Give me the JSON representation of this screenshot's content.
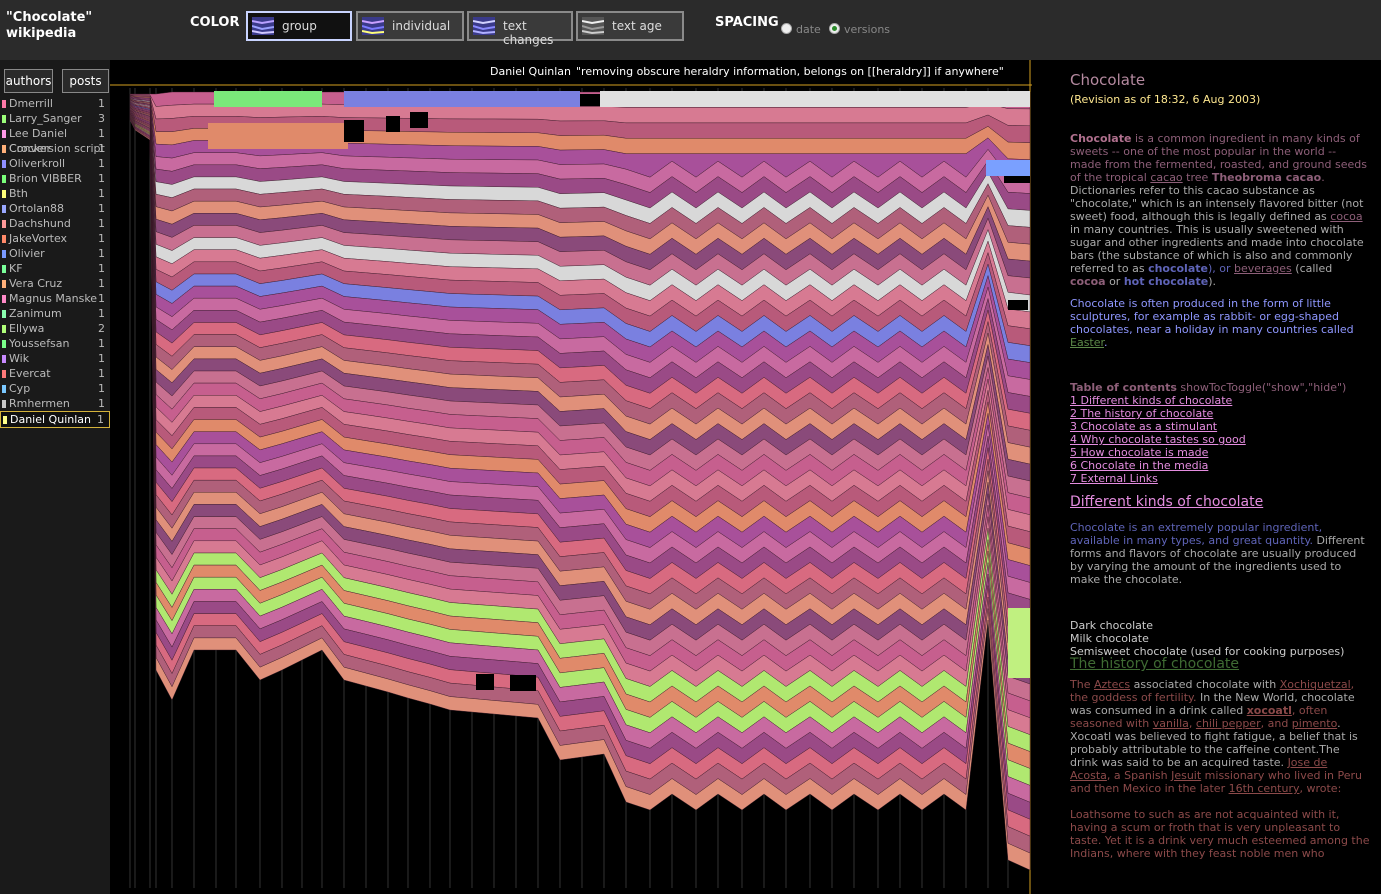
{
  "app": {
    "title_line1": "\"Chocolate\"",
    "title_line2": "wikipedia"
  },
  "color": {
    "label": "COLOR",
    "buttons": [
      {
        "label": "group",
        "active": true
      },
      {
        "label": "individual",
        "active": false
      },
      {
        "label": "text changes",
        "active": false
      },
      {
        "label": "text age",
        "active": false
      }
    ]
  },
  "spacing": {
    "label": "SPACING",
    "options": [
      {
        "label": "date",
        "selected": false
      },
      {
        "label": "versions",
        "selected": true
      }
    ]
  },
  "sidebar": {
    "tabs": [
      "authors",
      "posts"
    ],
    "authors": [
      {
        "name": "Dmerrill",
        "count": "1",
        "color": "#ff7aa8"
      },
      {
        "name": "Larry_Sanger",
        "count": "3",
        "color": "#9cff7a"
      },
      {
        "name": "Lee Daniel Crocker",
        "count": "1",
        "color": "#ff9ae6"
      },
      {
        "name": "Conversion script",
        "count": "1",
        "color": "#ffb07a"
      },
      {
        "name": "Oliverkroll",
        "count": "1",
        "color": "#8f8fff"
      },
      {
        "name": "Brion VIBBER",
        "count": "1",
        "color": "#7aff7a"
      },
      {
        "name": "Bth",
        "count": "1",
        "color": "#ffff7a"
      },
      {
        "name": "Ortolan88",
        "count": "1",
        "color": "#9aa8ff"
      },
      {
        "name": "Dachshund",
        "count": "1",
        "color": "#ff9a9a"
      },
      {
        "name": "JakeVortex",
        "count": "1",
        "color": "#ff8a6a"
      },
      {
        "name": "Olivier",
        "count": "1",
        "color": "#7a9aff"
      },
      {
        "name": "KF",
        "count": "1",
        "color": "#7aff9a"
      },
      {
        "name": "Vera Cruz",
        "count": "1",
        "color": "#ffb07a"
      },
      {
        "name": "Magnus Manske",
        "count": "1",
        "color": "#ff8ac8"
      },
      {
        "name": "Zanimum",
        "count": "1",
        "color": "#8affb0"
      },
      {
        "name": "Ellywa",
        "count": "2",
        "color": "#b0ff7a"
      },
      {
        "name": "Youssefsan",
        "count": "1",
        "color": "#7aff8a"
      },
      {
        "name": "Wik",
        "count": "1",
        "color": "#c88aff"
      },
      {
        "name": "Evercat",
        "count": "1",
        "color": "#ff7a7a"
      },
      {
        "name": "Cyp",
        "count": "1",
        "color": "#7ac8ff"
      },
      {
        "name": "Rmhermen",
        "count": "1",
        "color": "#c8c8c8"
      },
      {
        "name": "Daniel Quinlan",
        "count": "1",
        "color": "#ffff8a",
        "selected": true
      }
    ]
  },
  "tooltip": {
    "author": "Daniel Quinlan",
    "comment": "\"removing obscure heraldry information, belongs on [[heraldry]] if anywhere\""
  },
  "article": {
    "title": "Chocolate",
    "revision": "(Revision as of 18:32, 6 Aug 2003)",
    "toc_title": "Table of contents",
    "toc_toggle": "showTocToggle(\"show\",\"hide\")",
    "toc": [
      "1 Different kinds of chocolate",
      "2 The history of chocolate",
      "3 Chocolate as a stimulant",
      "4 Why chocolate tastes so good",
      "5 How chocolate is made",
      "6 Chocolate in the media",
      "7 External Links"
    ],
    "h_kinds": "Different kinds of chocolate",
    "kinds_list": [
      "Dark chocolate",
      "Milk chocolate",
      "Semisweet chocolate (used for cooking purposes)"
    ],
    "h_history": "The history of chocolate"
  }
}
